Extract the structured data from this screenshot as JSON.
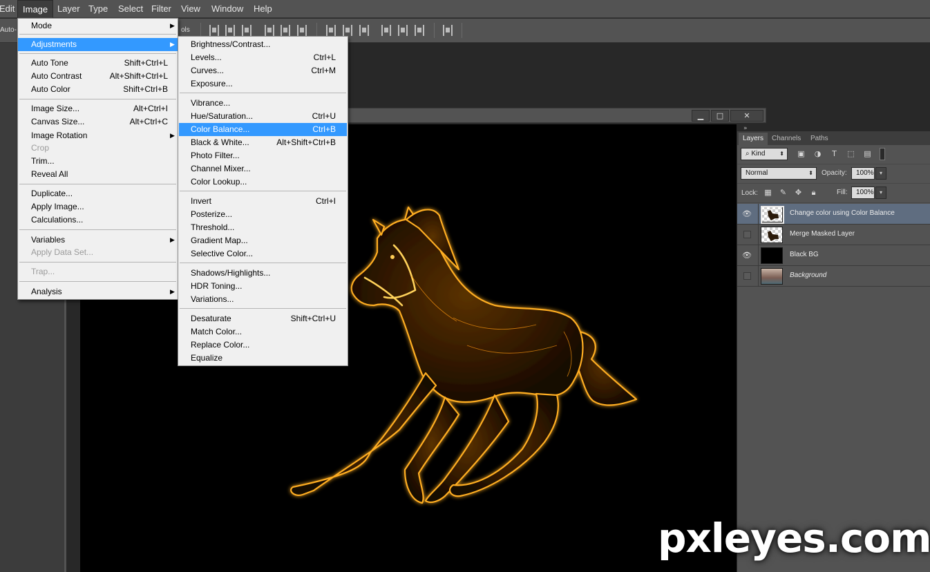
{
  "menubar": {
    "items": [
      "Edit",
      "Image",
      "Layer",
      "Type",
      "Select",
      "Filter",
      "View",
      "Window",
      "Help"
    ],
    "active": "Image"
  },
  "options_bar": {
    "auto_label": "Auto-",
    "controls_label": "ols"
  },
  "doc_window": {
    "minimize": "▁",
    "maximize": "□",
    "close": "✕",
    "scroll_chevron": "»"
  },
  "image_menu": {
    "items": [
      {
        "label": "Mode",
        "submenu": true
      },
      {
        "label": "Adjustments",
        "submenu": true,
        "highlighted": true
      },
      {
        "label": "Auto Tone",
        "shortcut": "Shift+Ctrl+L"
      },
      {
        "label": "Auto Contrast",
        "shortcut": "Alt+Shift+Ctrl+L"
      },
      {
        "label": "Auto Color",
        "shortcut": "Shift+Ctrl+B"
      },
      {
        "label": "Image Size...",
        "shortcut": "Alt+Ctrl+I"
      },
      {
        "label": "Canvas Size...",
        "shortcut": "Alt+Ctrl+C"
      },
      {
        "label": "Image Rotation",
        "submenu": true
      },
      {
        "label": "Crop",
        "disabled": true
      },
      {
        "label": "Trim..."
      },
      {
        "label": "Reveal All"
      },
      {
        "label": "Duplicate..."
      },
      {
        "label": "Apply Image..."
      },
      {
        "label": "Calculations..."
      },
      {
        "label": "Variables",
        "submenu": true
      },
      {
        "label": "Apply Data Set...",
        "disabled": true
      },
      {
        "label": "Trap...",
        "disabled": true
      },
      {
        "label": "Analysis",
        "submenu": true
      }
    ]
  },
  "adjustments_menu": {
    "items": [
      {
        "label": "Brightness/Contrast..."
      },
      {
        "label": "Levels...",
        "shortcut": "Ctrl+L"
      },
      {
        "label": "Curves...",
        "shortcut": "Ctrl+M"
      },
      {
        "label": "Exposure..."
      },
      {
        "label": "Vibrance..."
      },
      {
        "label": "Hue/Saturation...",
        "shortcut": "Ctrl+U"
      },
      {
        "label": "Color Balance...",
        "shortcut": "Ctrl+B",
        "highlighted": true
      },
      {
        "label": "Black & White...",
        "shortcut": "Alt+Shift+Ctrl+B"
      },
      {
        "label": "Photo Filter..."
      },
      {
        "label": "Channel Mixer..."
      },
      {
        "label": "Color Lookup..."
      },
      {
        "label": "Invert",
        "shortcut": "Ctrl+I"
      },
      {
        "label": "Posterize..."
      },
      {
        "label": "Threshold..."
      },
      {
        "label": "Gradient Map..."
      },
      {
        "label": "Selective Color..."
      },
      {
        "label": "Shadows/Highlights..."
      },
      {
        "label": "HDR Toning..."
      },
      {
        "label": "Variations..."
      },
      {
        "label": "Desaturate",
        "shortcut": "Shift+Ctrl+U"
      },
      {
        "label": "Match Color..."
      },
      {
        "label": "Replace Color..."
      },
      {
        "label": "Equalize"
      }
    ]
  },
  "layers_panel": {
    "tabs": [
      "Layers",
      "Channels",
      "Paths"
    ],
    "active_tab": "Layers",
    "kind_label": "Kind",
    "blend_mode": "Normal",
    "opacity_label": "Opacity:",
    "opacity_value": "100%",
    "lock_label": "Lock:",
    "fill_label": "Fill:",
    "fill_value": "100%",
    "layers": [
      {
        "name": "Change color using Color Balance",
        "visible": true,
        "selected": true,
        "thumb": "checker"
      },
      {
        "name": "Merge Masked Layer",
        "visible": false,
        "selected": false,
        "thumb": "checker"
      },
      {
        "name": "Black BG",
        "visible": true,
        "selected": false,
        "thumb": "black"
      },
      {
        "name": "Background",
        "visible": false,
        "selected": false,
        "thumb": "photo",
        "italic": true
      }
    ]
  },
  "watermark": "pxleyes.com",
  "colors": {
    "menu_highlight": "#3399ff",
    "panel_bg": "#535353",
    "selected_layer": "#5f6d80",
    "glow": "#ffb000"
  }
}
